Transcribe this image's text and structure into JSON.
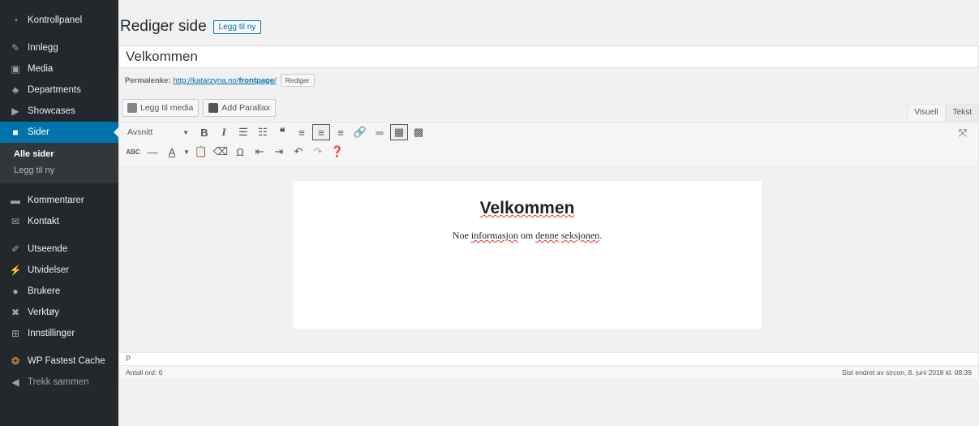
{
  "sidebar": {
    "items": [
      {
        "label": "Kontrollpanel",
        "icon": "dashboard-icon"
      },
      {
        "label": "Innlegg",
        "icon": "pin-icon"
      },
      {
        "label": "Media",
        "icon": "media-icon"
      },
      {
        "label": "Departments",
        "icon": "groups-icon"
      },
      {
        "label": "Showcases",
        "icon": "video-icon"
      },
      {
        "label": "Sider",
        "icon": "page-icon"
      },
      {
        "label": "Kommentarer",
        "icon": "comment-icon"
      },
      {
        "label": "Kontakt",
        "icon": "email-icon"
      },
      {
        "label": "Utseende",
        "icon": "brush-icon"
      },
      {
        "label": "Utvidelser",
        "icon": "plugin-icon"
      },
      {
        "label": "Brukere",
        "icon": "users-icon"
      },
      {
        "label": "Verktøy",
        "icon": "wrench-icon"
      },
      {
        "label": "Innstillinger",
        "icon": "settings-icon"
      },
      {
        "label": "WP Fastest Cache",
        "icon": "cheetah-icon"
      },
      {
        "label": "Trekk sammen",
        "icon": "collapse-icon"
      }
    ],
    "submenu": {
      "all_pages": "Alle sider",
      "add_new": "Legg til ny"
    }
  },
  "header": {
    "title": "Rediger side",
    "add_new": "Legg til ny"
  },
  "post_title": "Velkommen",
  "permalink": {
    "label": "Permalenke:",
    "url_prefix": "http://katarzyna.no/",
    "slug": "frontpage",
    "url_suffix": "/",
    "edit": "Rediger"
  },
  "media": {
    "add_media": "Legg til media",
    "add_parallax": "Add Parallax"
  },
  "tabs": {
    "visual": "Visuell",
    "text": "Tekst"
  },
  "toolbar": {
    "format": "Avsnitt"
  },
  "doc": {
    "heading": "Velkommen",
    "text_parts": [
      "Noe ",
      "informasjon",
      " om ",
      "denne",
      " ",
      "seksjonen",
      "."
    ]
  },
  "status": {
    "path": "P",
    "word_count": "Antall ord: 6",
    "last_edited": "Sist endret av sircon, 8. juni 2018 kl. 08:39"
  },
  "colors": {
    "sidebar_bg": "#23282d",
    "accent": "#0073aa",
    "spellcheck": "#dd3333"
  }
}
